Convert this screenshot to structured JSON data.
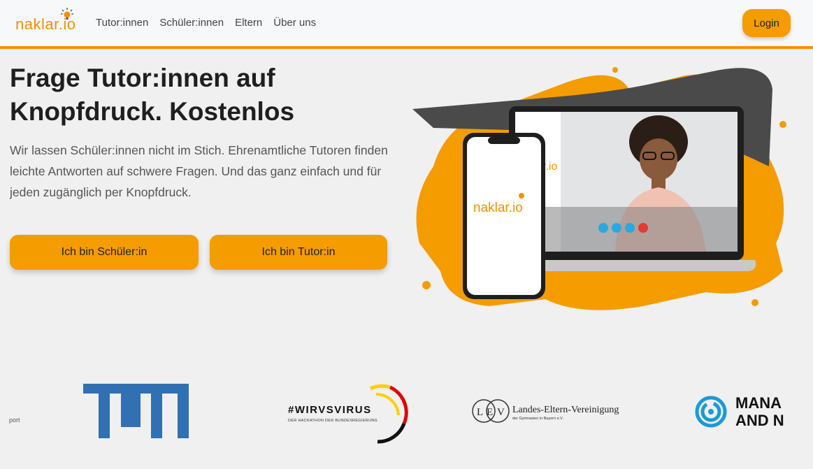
{
  "header": {
    "logo_text": "naklar.io",
    "nav": [
      {
        "label": "Tutor:innen"
      },
      {
        "label": "Schüler:innen"
      },
      {
        "label": "Eltern"
      },
      {
        "label": "Über uns"
      }
    ],
    "login_label": "Login"
  },
  "hero": {
    "title": "Frage Tutor:innen auf Knopfdruck. Kostenlos",
    "description": "Wir lassen Schüler:innen nicht im Stich. Ehrenamtliche Tutoren finden leichte Antworten auf schwere Fragen. Und das ganz einfach und für jeden zugänglich per Knopfdruck.",
    "cta_student": "Ich bin Schüler:in",
    "cta_tutor": "Ich bin Tutor:in"
  },
  "illustration": {
    "phone_logo": "naklar.io",
    "laptop_logo": "r.io"
  },
  "partners": {
    "partial_left": "port",
    "wirvsvirus": "#WIRVSVIRUS",
    "wirvsvirus_sub": "DER HACKATHON DER BUNDESREGIERUNG",
    "lev_name": "Landes-Eltern-Vereinigung",
    "lev_sub": "der Gymnasien in Bayern e.V.",
    "manage_line1": "MANA",
    "manage_line2": "AND N"
  },
  "colors": {
    "accent": "#f29100",
    "button": "#f59c00",
    "tum_blue": "#3070b3",
    "background": "#f0f0f0"
  }
}
